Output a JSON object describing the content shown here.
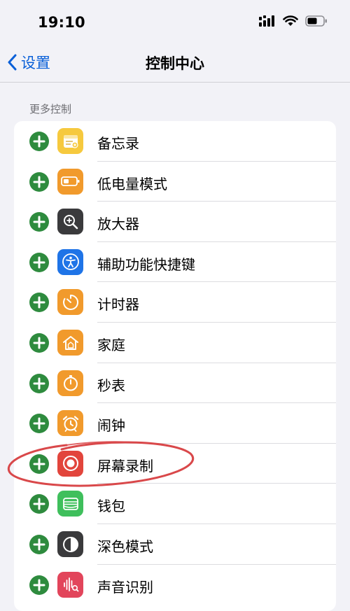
{
  "status_bar": {
    "time": "19:10",
    "icons": [
      "cellular-signal-icon",
      "wifi-icon",
      "battery-icon"
    ]
  },
  "nav": {
    "back_label": "设置",
    "title": "控制中心"
  },
  "section": {
    "header": "更多控制"
  },
  "items": [
    {
      "label": "备忘录",
      "icon": "notes-icon",
      "color": "#f6c93e"
    },
    {
      "label": "低电量模式",
      "icon": "low-power-battery-icon",
      "color": "#f19a2c"
    },
    {
      "label": "放大器",
      "icon": "magnifier-icon",
      "color": "#3a3a3c"
    },
    {
      "label": "辅助功能快捷键",
      "icon": "accessibility-icon",
      "color": "#1f74e7"
    },
    {
      "label": "计时器",
      "icon": "timer-icon",
      "color": "#f19a2c"
    },
    {
      "label": "家庭",
      "icon": "home-icon",
      "color": "#f19a2c"
    },
    {
      "label": "秒表",
      "icon": "stopwatch-icon",
      "color": "#f19a2c"
    },
    {
      "label": "闹钟",
      "icon": "alarm-icon",
      "color": "#f19a2c"
    },
    {
      "label": "屏幕录制",
      "icon": "screen-recording-icon",
      "color": "#e2453c"
    },
    {
      "label": "钱包",
      "icon": "wallet-icon",
      "color": "#3fbf5c"
    },
    {
      "label": "深色模式",
      "icon": "dark-mode-icon",
      "color": "#3a3a3c"
    },
    {
      "label": "声音识别",
      "icon": "sound-recognition-icon",
      "color": "#e2455b"
    }
  ],
  "accent": "#0a60d8",
  "add_button_color": "#2e8b3e",
  "annotation_color": "#d9484a"
}
